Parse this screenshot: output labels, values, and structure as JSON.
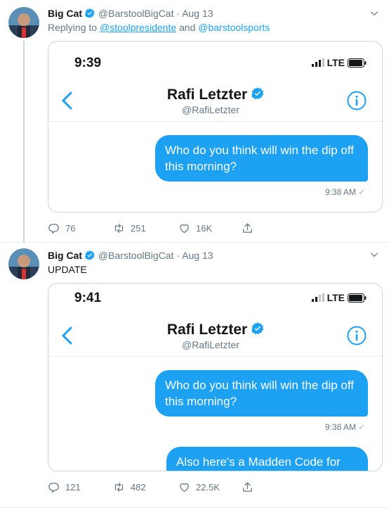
{
  "tweets": [
    {
      "author_name": "Big Cat",
      "author_handle": "@BarstoolBigCat",
      "separator": "·",
      "date": "Aug 13",
      "reply_prefix": "Replying to",
      "reply_mention_1": "@stoolpresidente",
      "reply_and": "and",
      "reply_mention_2": "@barstoolsports",
      "screenshot": {
        "phone_time": "9:39",
        "network": "LTE",
        "contact_name": "Rafi Letzter",
        "contact_handle": "@RafiLetzter",
        "messages": [
          {
            "text": "Who do you think will win the dip off this morning?",
            "time": "9:38 AM",
            "check": "✓"
          }
        ]
      },
      "actions": {
        "replies": "76",
        "retweets": "251",
        "likes": "16K"
      }
    },
    {
      "author_name": "Big Cat",
      "author_handle": "@BarstoolBigCat",
      "separator": "·",
      "date": "Aug 13",
      "text": "UPDATE",
      "screenshot": {
        "phone_time": "9:41",
        "network": "LTE",
        "contact_name": "Rafi Letzter",
        "contact_handle": "@RafiLetzter",
        "messages": [
          {
            "text": "Who do you think will win the dip off this morning?",
            "time": "9:38 AM",
            "check": "✓"
          },
          {
            "text": "Also here's a Madden Code for"
          }
        ]
      },
      "actions": {
        "replies": "121",
        "retweets": "482",
        "likes": "22.5K"
      }
    }
  ],
  "colors": {
    "accent": "#1da1f2",
    "muted": "#657786",
    "border": "#ccd6dd"
  }
}
